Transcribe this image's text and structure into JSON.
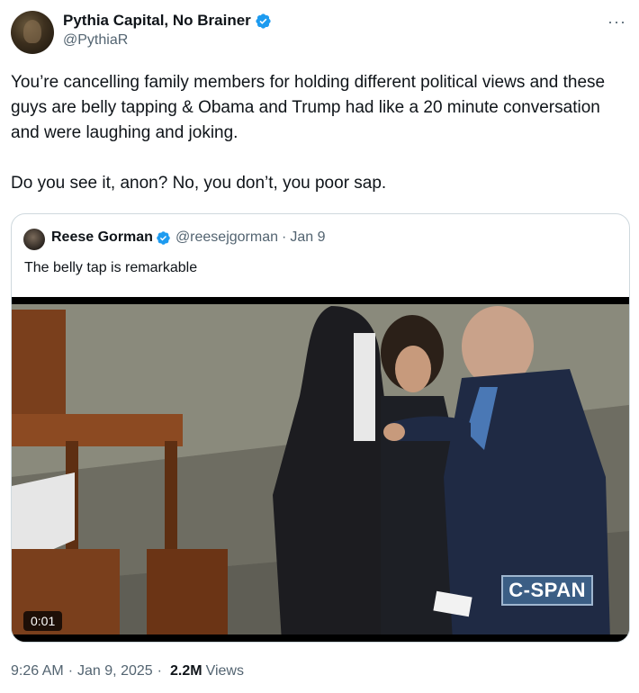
{
  "author": {
    "name": "Pythia Capital, No Brainer",
    "handle": "@PythiaR"
  },
  "tweet": {
    "text": "You’re cancelling family members for holding different political views and these guys are belly tapping & Obama and Trump had like a 20 minute conversation and were laughing and joking.\n\nDo you see it, anon? No, you don’t, you poor sap."
  },
  "more_label": "···",
  "quote": {
    "name": "Reese Gorman",
    "handle": "@reesejgorman",
    "separator": "·",
    "date": "Jan 9",
    "text": "The belly tap is remarkable",
    "video": {
      "duration": "0:01",
      "watermark": "C-SPAN"
    }
  },
  "footer": {
    "time": "9:26 AM",
    "separator": "·",
    "date": "Jan 9, 2025",
    "views_count": "2.2M",
    "views_label": "Views"
  },
  "colors": {
    "verified": "#1d9bf0",
    "text_primary": "#0f1419",
    "text_secondary": "#536471",
    "border": "#cfd9de"
  }
}
